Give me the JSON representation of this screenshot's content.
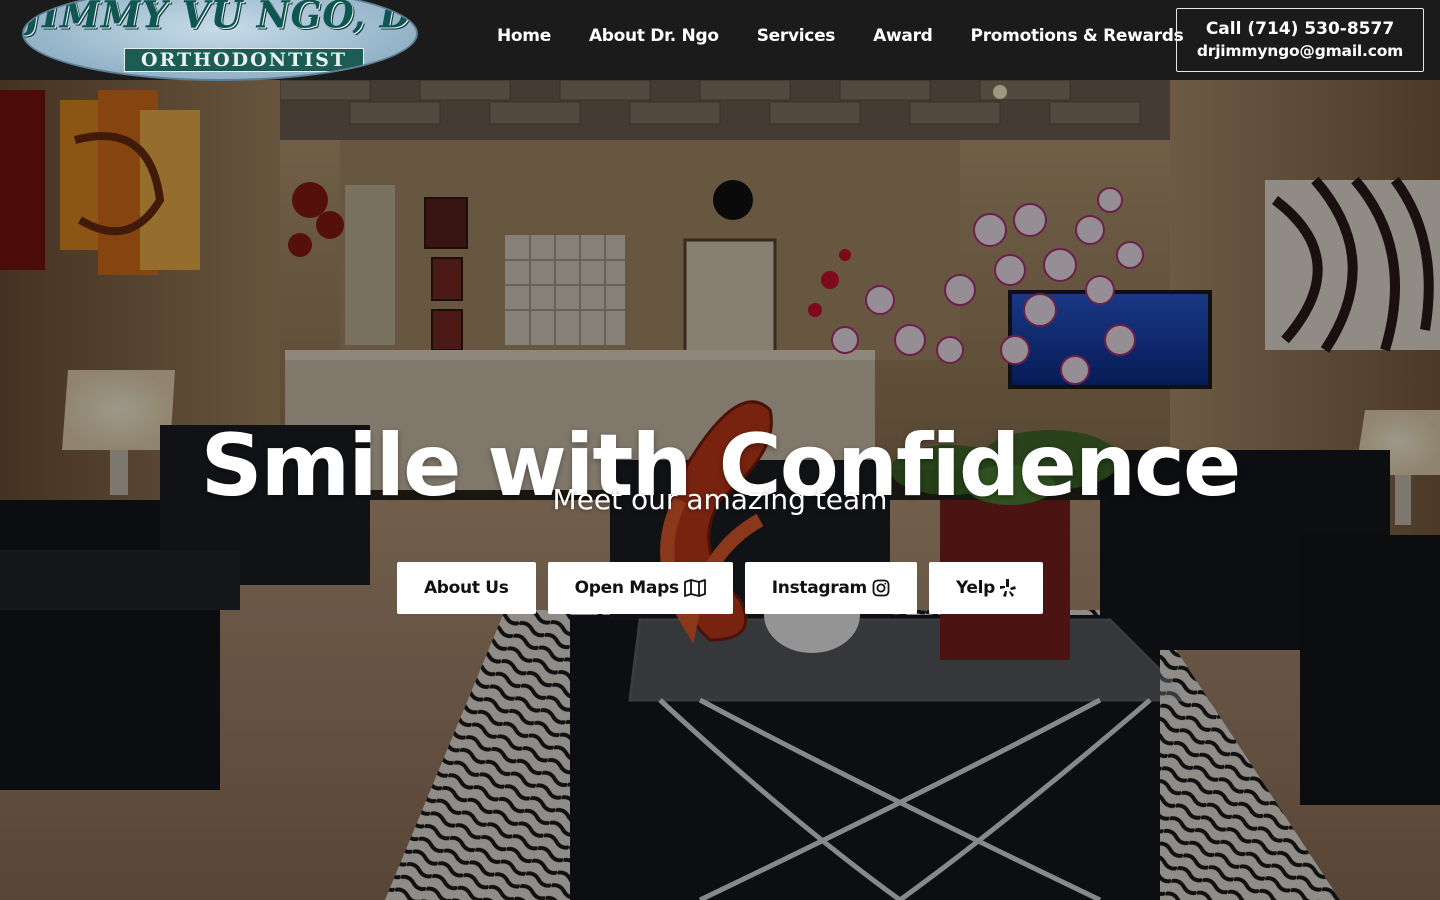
{
  "logo": {
    "name": "JIMMY VU NGO, D.D.S.",
    "subtitle": "ORTHODONTIST"
  },
  "nav": {
    "items": [
      {
        "label": "Home"
      },
      {
        "label": "About Dr. Ngo"
      },
      {
        "label": "Services"
      },
      {
        "label": "Award"
      },
      {
        "label": "Promotions & Rewards"
      }
    ]
  },
  "contact": {
    "phone": "Call (714) 530-8577",
    "email": "drjimmyngo@gmail.com"
  },
  "hero": {
    "title": "Smile with Confidence",
    "subtitle": "Meet our amazing team",
    "buttons": [
      {
        "label": "About Us",
        "icon": ""
      },
      {
        "label": "Open Maps",
        "icon": "map-icon"
      },
      {
        "label": "Instagram",
        "icon": "instagram-icon"
      },
      {
        "label": "Yelp",
        "icon": "yelp-icon"
      }
    ]
  },
  "colors": {
    "header_bg": "#1b1b1b",
    "button_bg": "#ffffff",
    "text_light": "#ffffff"
  }
}
